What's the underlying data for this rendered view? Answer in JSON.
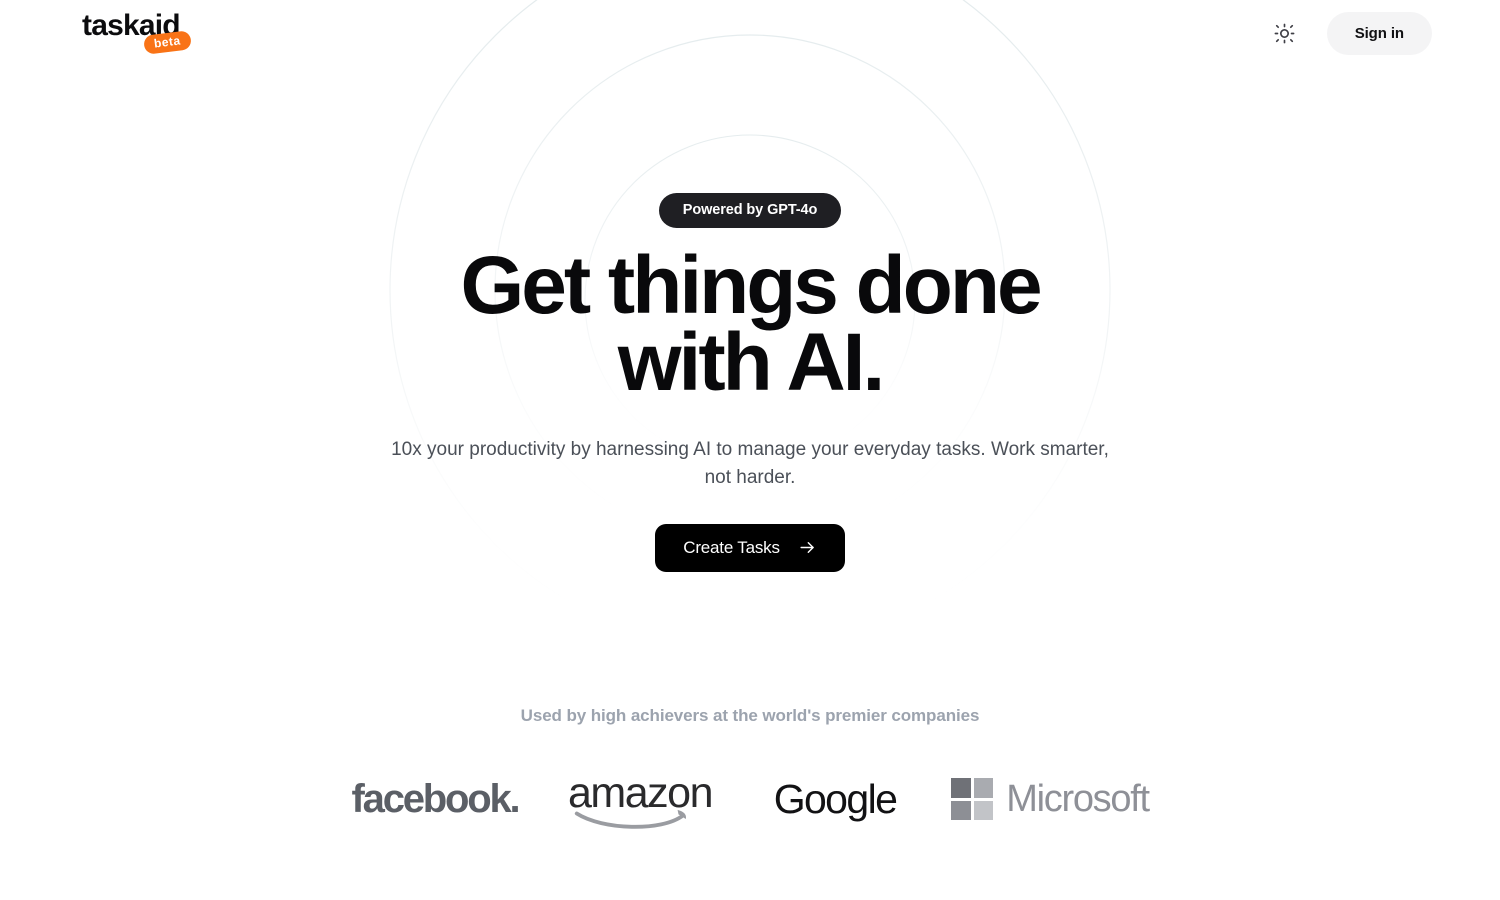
{
  "brand": {
    "name": "taskaid",
    "badge_label": "beta",
    "badge_color": "#F97316"
  },
  "header": {
    "theme_toggle_icon": "sun-icon",
    "sign_in_label": "Sign in"
  },
  "hero": {
    "badge_label": "Powered by GPT-4o",
    "headline": "Get things done with AI.",
    "subtitle": "10x your productivity by harnessing AI to manage your everyday tasks. Work smarter, not harder.",
    "cta_label": "Create Tasks",
    "cta_icon": "arrow-right-icon",
    "cta_background": "#000000"
  },
  "social_proof": {
    "title": "Used by high achievers at the world's premier companies",
    "logos": [
      {
        "name": "facebook",
        "wordmark": "facebook."
      },
      {
        "name": "amazon",
        "wordmark": "amazon"
      },
      {
        "name": "google",
        "wordmark": "Google"
      },
      {
        "name": "microsoft",
        "wordmark": "Microsoft"
      }
    ]
  },
  "microsoft_squares": {
    "top_left": "#6f7177",
    "top_right": "#a9abb0",
    "bottom_left": "#8d8f95",
    "bottom_right": "#c2c4c8"
  },
  "decor": {
    "ring_color": "#e9edef",
    "ring_count": 3
  }
}
